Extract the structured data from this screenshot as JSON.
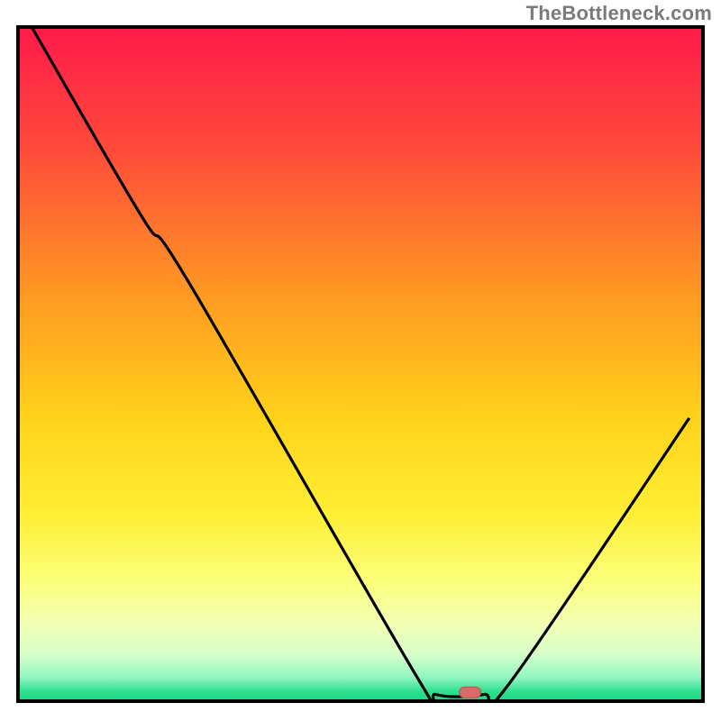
{
  "attribution": "TheBottleneck.com",
  "chart_data": {
    "type": "line",
    "title": "",
    "xlabel": "",
    "ylabel": "",
    "xlim": [
      0,
      100
    ],
    "ylim": [
      0,
      100
    ],
    "gradient_stops": [
      {
        "offset": 0.0,
        "color": "#ff1a4a"
      },
      {
        "offset": 0.18,
        "color": "#ff4a3a"
      },
      {
        "offset": 0.4,
        "color": "#ff9a22"
      },
      {
        "offset": 0.58,
        "color": "#ffd21a"
      },
      {
        "offset": 0.72,
        "color": "#ffee33"
      },
      {
        "offset": 0.82,
        "color": "#fbff7a"
      },
      {
        "offset": 0.88,
        "color": "#f3ffb0"
      },
      {
        "offset": 0.93,
        "color": "#d8ffca"
      },
      {
        "offset": 0.965,
        "color": "#90f7c0"
      },
      {
        "offset": 0.985,
        "color": "#30e090"
      },
      {
        "offset": 1.0,
        "color": "#18d880"
      }
    ],
    "series": [
      {
        "name": "bottleneck-curve",
        "color": "#000000",
        "points": [
          {
            "x": 2.0,
            "y": 100.0
          },
          {
            "x": 18.0,
            "y": 72.0
          },
          {
            "x": 25.0,
            "y": 62.0
          },
          {
            "x": 58.0,
            "y": 4.0
          },
          {
            "x": 61.0,
            "y": 1.0
          },
          {
            "x": 68.0,
            "y": 1.0
          },
          {
            "x": 72.0,
            "y": 3.0
          },
          {
            "x": 98.0,
            "y": 42.0
          }
        ]
      }
    ],
    "marker": {
      "x": 66.0,
      "y": 1.3,
      "color_fill": "#d86a6a",
      "color_stroke": "#c05050"
    },
    "axes_color": "#000000"
  }
}
